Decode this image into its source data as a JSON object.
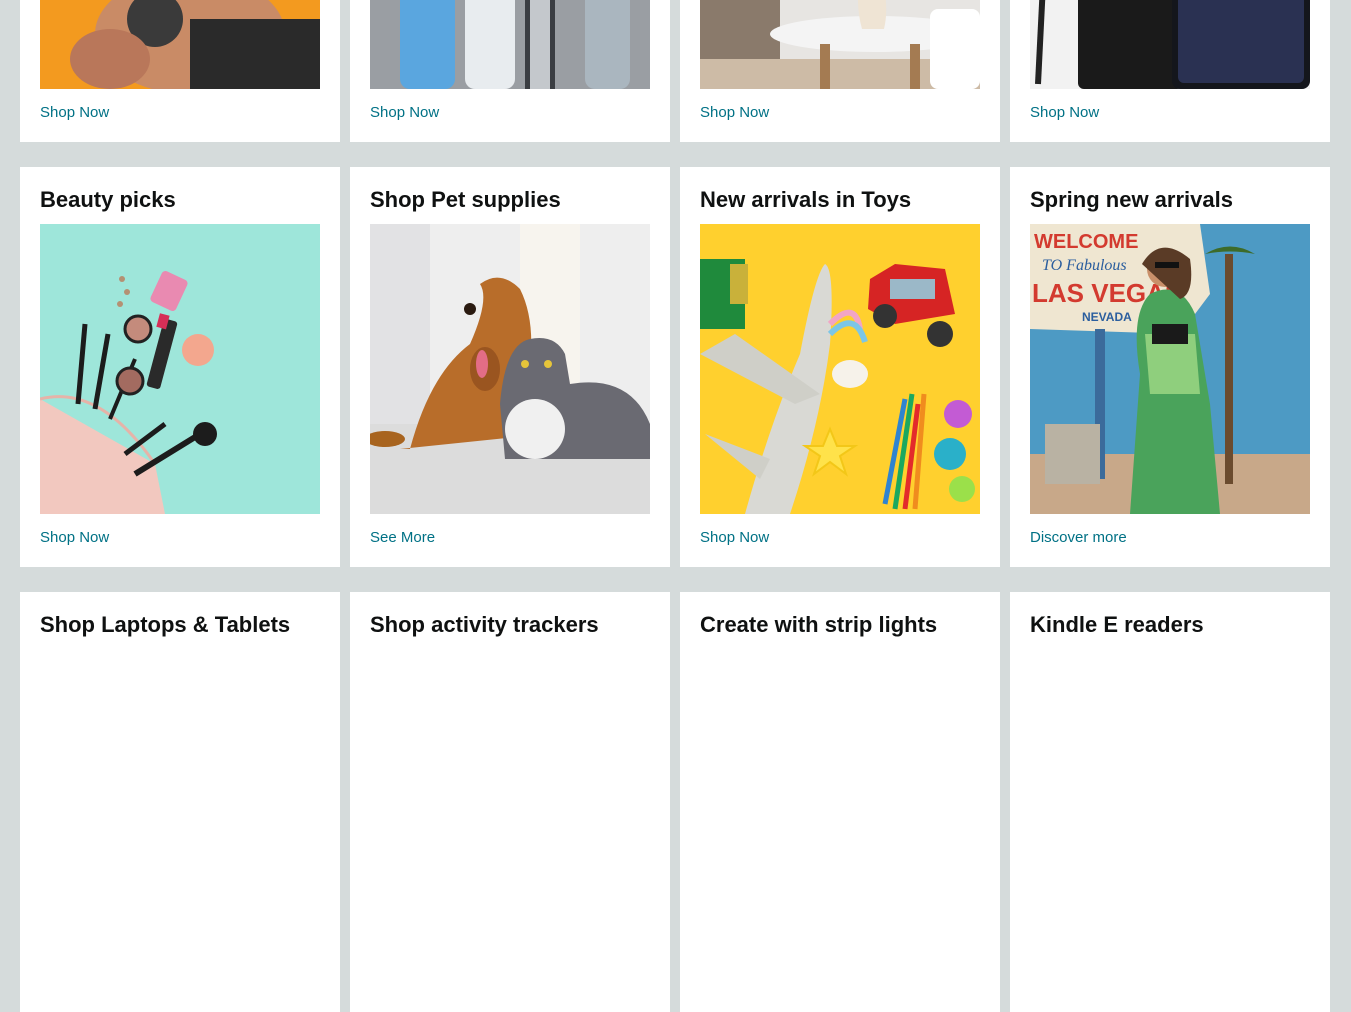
{
  "row_top": {
    "cards": [
      {
        "link": "Shop Now",
        "image_icon": "fitness-image"
      },
      {
        "link": "Shop Now",
        "image_icon": "water-bottles-image"
      },
      {
        "link": "Shop Now",
        "image_icon": "home-decor-image"
      },
      {
        "link": "Shop Now",
        "image_icon": "samsung-phone-image"
      }
    ]
  },
  "row_middle": {
    "cards": [
      {
        "title": "Beauty picks",
        "link": "Shop Now",
        "image_icon": "makeup-image"
      },
      {
        "title": "Shop Pet supplies",
        "link": "See More",
        "image_icon": "dog-and-cat-image"
      },
      {
        "title": "New arrivals in Toys",
        "link": "Shop Now",
        "image_icon": "toys-image"
      },
      {
        "title": "Spring new arrivals",
        "link": "Discover more",
        "image_icon": "las-vegas-fashion-image",
        "sign_text": [
          "WELCOME",
          "TO Fabulous",
          "LAS VEGAS",
          "NEVADA"
        ]
      }
    ]
  },
  "row_bottom": {
    "cards": [
      {
        "title": "Shop Laptops & Tablets"
      },
      {
        "title": "Shop activity trackers"
      },
      {
        "title": "Create with strip lights"
      },
      {
        "title": "Kindle E readers"
      }
    ]
  },
  "colors": {
    "page_bg": "#d5dbdb",
    "card_bg": "#ffffff",
    "link": "#007185",
    "title": "#0f1111"
  }
}
